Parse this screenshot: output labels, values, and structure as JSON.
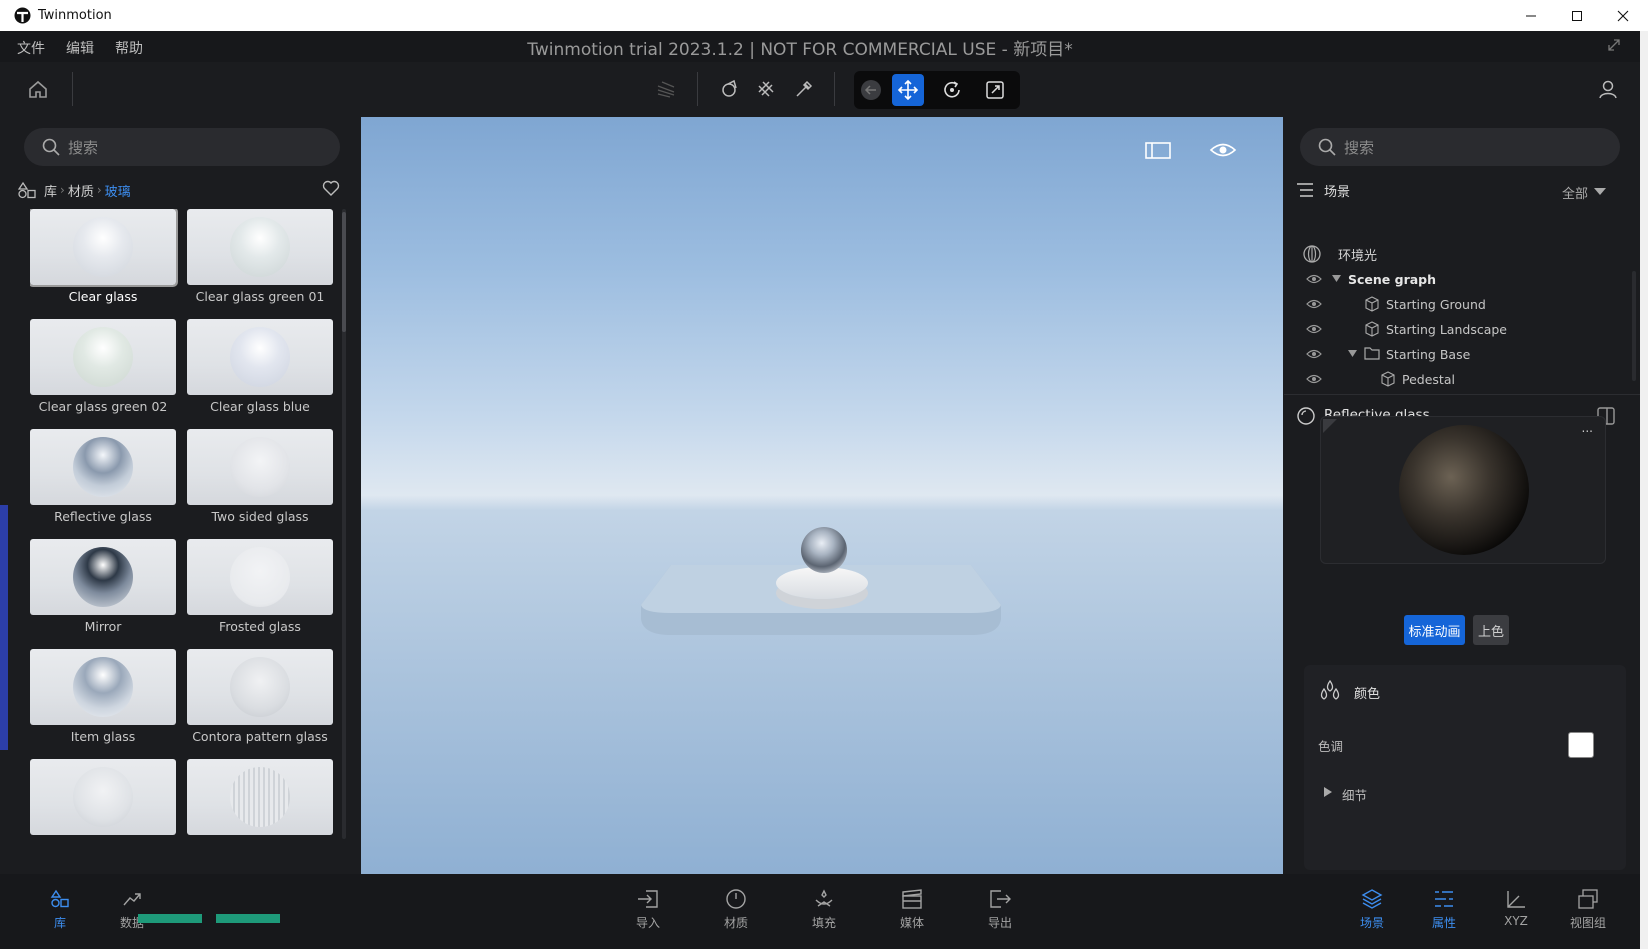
{
  "window": {
    "title": "Twinmotion",
    "controls": [
      "minimize-icon",
      "maximize-icon",
      "close-icon"
    ]
  },
  "menubar": {
    "items": [
      "文件",
      "编辑",
      "帮助"
    ],
    "app_title": "Twinmotion trial 2023.1.2 | NOT FOR COMMERCIAL USE - 新项目*"
  },
  "toolbar": {
    "icons": [
      "home-icon",
      "lines-icon",
      "shapes-icon",
      "hatch-icon",
      "eyedropper-icon",
      "back-arrow-icon",
      "move-icon",
      "rotate-icon",
      "scale-icon",
      "user-icon"
    ],
    "active_tool": "move-icon",
    "accent": "#1565d8"
  },
  "library": {
    "search_placeholder": "搜索",
    "breadcrumb": [
      "库",
      "材质",
      "玻璃"
    ],
    "items": [
      {
        "label": "Clear glass",
        "selected": true
      },
      {
        "label": "Clear glass green 01"
      },
      {
        "label": "Clear glass green 02"
      },
      {
        "label": "Clear glass blue"
      },
      {
        "label": "Reflective glass"
      },
      {
        "label": "Two sided glass"
      },
      {
        "label": "Mirror"
      },
      {
        "label": "Frosted glass"
      },
      {
        "label": "Item glass"
      },
      {
        "label": "Contora pattern glass"
      },
      {
        "label": ""
      },
      {
        "label": ""
      }
    ]
  },
  "viewport": {
    "icons": [
      "panel-icon",
      "eye-icon"
    ]
  },
  "scene": {
    "search_placeholder": "搜索",
    "title": "场景",
    "filter": "全部",
    "rows": [
      {
        "label": "环境光",
        "icon": "globe-icon",
        "indent": 0
      },
      {
        "label": "Scene graph",
        "indent": 0,
        "expanded": true,
        "bold": true
      },
      {
        "label": "Starting Ground",
        "icon": "object-icon",
        "indent": 1
      },
      {
        "label": "Starting Landscape",
        "icon": "object-icon",
        "indent": 1
      },
      {
        "label": "Starting Base",
        "icon": "folder-icon",
        "indent": 1,
        "expanded": true
      },
      {
        "label": "Pedestal",
        "icon": "object-icon",
        "indent": 2
      }
    ]
  },
  "material": {
    "name": "Reflective glass",
    "more": "...",
    "tab_standard": "标准动画",
    "tab_color": "上色",
    "section_color": "颜色",
    "tint_label": "色调",
    "tint_value": "#ffffff",
    "details_label": "细节"
  },
  "bottombar": {
    "left": [
      {
        "label": "库",
        "icon": "library-icon",
        "active": true
      },
      {
        "label": "数据",
        "icon": "chart-up-icon"
      }
    ],
    "center": [
      {
        "label": "导入",
        "icon": "import-icon"
      },
      {
        "label": "材质",
        "icon": "material-icon"
      },
      {
        "label": "填充",
        "icon": "fill-icon"
      },
      {
        "label": "媒体",
        "icon": "media-icon"
      },
      {
        "label": "导出",
        "icon": "export-icon"
      }
    ],
    "right": [
      {
        "label": "场景",
        "icon": "layers-icon",
        "active": true
      },
      {
        "label": "属性",
        "icon": "properties-icon",
        "active": true
      },
      {
        "label": "XYZ",
        "icon": "axis-icon"
      },
      {
        "label": "视图组",
        "icon": "views-icon"
      }
    ]
  }
}
